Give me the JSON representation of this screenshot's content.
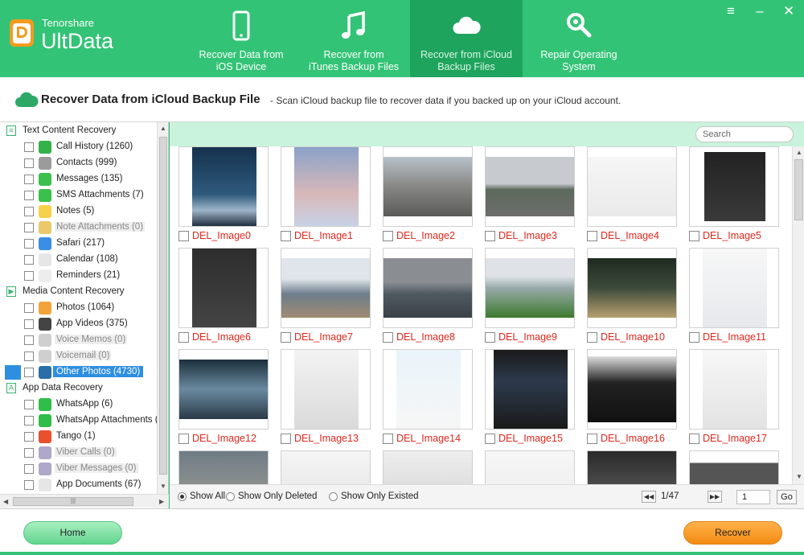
{
  "app": {
    "brand_sub": "Tenorshare",
    "brand_main": "UltData"
  },
  "window_buttons": {
    "menu": "≡",
    "minimize": "–",
    "close": "✕"
  },
  "tabs": [
    {
      "line1": "Recover Data from",
      "line2": "iOS Device",
      "icon": "phone-icon",
      "active": false
    },
    {
      "line1": "Recover from",
      "line2": "iTunes Backup Files",
      "icon": "music-note-icon",
      "active": false
    },
    {
      "line1": "Recover from iCloud",
      "line2": "Backup Files",
      "icon": "cloud-icon",
      "active": true
    },
    {
      "line1": "Repair Operating",
      "line2": "System",
      "icon": "wrench-icon",
      "active": false
    }
  ],
  "titleband": {
    "title": "Recover Data from iCloud Backup File",
    "subtitle": "- Scan iCloud backup file to recover data if you backed up on your iCloud account."
  },
  "tree": {
    "categories": [
      {
        "label": "Text Content Recovery",
        "icon": "≡"
      },
      {
        "label": "Media Content Recovery",
        "icon": "▶"
      },
      {
        "label": "App Data Recovery",
        "icon": "A"
      }
    ],
    "items": [
      {
        "label": "Call History (1260)",
        "icon": "phone-icon",
        "color": "#33b24a",
        "disabled": false
      },
      {
        "label": "Contacts (999)",
        "icon": "contacts-icon",
        "color": "#9b9b9b",
        "disabled": false
      },
      {
        "label": "Messages (135)",
        "icon": "message-icon",
        "color": "#3cc04c",
        "disabled": false
      },
      {
        "label": "SMS Attachments (7)",
        "icon": "paperclip-icon",
        "color": "#3cc04c",
        "disabled": false
      },
      {
        "label": "Notes (5)",
        "icon": "notes-icon",
        "color": "#f6d24a",
        "disabled": false
      },
      {
        "label": "Note Attachments (0)",
        "icon": "note-attachment-icon",
        "color": "#e9c96b",
        "disabled": true
      },
      {
        "label": "Safari (217)",
        "icon": "safari-icon",
        "color": "#3a8ee6",
        "disabled": false
      },
      {
        "label": "Calendar (108)",
        "icon": "calendar-icon",
        "color": "#e6e6e6",
        "disabled": false
      },
      {
        "label": "Reminders (21)",
        "icon": "reminders-icon",
        "color": "#ededed",
        "disabled": false
      },
      {
        "label": "Photos (1064)",
        "icon": "photos-icon",
        "color": "#f2a33a",
        "disabled": false
      },
      {
        "label": "App Videos (375)",
        "icon": "clapper-icon",
        "color": "#444444",
        "disabled": false
      },
      {
        "label": "Voice Memos (0)",
        "icon": "voice-memo-icon",
        "color": "#cfcfcf",
        "disabled": true
      },
      {
        "label": "Voicemail (0)",
        "icon": "voicemail-icon",
        "color": "#cfcfcf",
        "disabled": true
      },
      {
        "label": "Other Photos (4730)",
        "icon": "landscape-icon",
        "color": "#2a6ea8",
        "disabled": false,
        "selected": true
      },
      {
        "label": "WhatsApp (6)",
        "icon": "whatsapp-icon",
        "color": "#2fbe48",
        "disabled": false
      },
      {
        "label": "WhatsApp Attachments (",
        "icon": "whatsapp-attachment-icon",
        "color": "#2fbe48",
        "disabled": false
      },
      {
        "label": "Tango (1)",
        "icon": "tango-icon",
        "color": "#e8502e",
        "disabled": false
      },
      {
        "label": "Viber Calls (0)",
        "icon": "viber-calls-icon",
        "color": "#b0a8c8",
        "disabled": true
      },
      {
        "label": "Viber Messages (0)",
        "icon": "viber-messages-icon",
        "color": "#b0a8c8",
        "disabled": true
      },
      {
        "label": "App Documents (67)",
        "icon": "documents-icon",
        "color": "#e6e6e6",
        "disabled": false
      }
    ]
  },
  "search": {
    "placeholder": "Search"
  },
  "images": [
    "DEL_Image0",
    "DEL_Image1",
    "DEL_Image2",
    "DEL_Image3",
    "DEL_Image4",
    "DEL_Image5",
    "DEL_Image6",
    "DEL_Image7",
    "DEL_Image8",
    "DEL_Image9",
    "DEL_Image10",
    "DEL_Image11",
    "DEL_Image12",
    "DEL_Image13",
    "DEL_Image14",
    "DEL_Image15",
    "DEL_Image16",
    "DEL_Image17"
  ],
  "filters": {
    "show_all": "Show All",
    "show_deleted": "Show Only Deleted",
    "show_existed": "Show Only Existed",
    "selected": "show_all"
  },
  "pagination": {
    "prev": "◀◀",
    "current": "1/47",
    "next": "▶▶",
    "page_input": "1",
    "go": "Go"
  },
  "footer": {
    "home": "Home",
    "recover": "Recover"
  },
  "colors": {
    "brand_green": "#33c376",
    "tab_active": "#1fa45d",
    "deleted_red": "#e0281d",
    "recover_orange": "#f38b13",
    "selection_blue": "#2e8fe0"
  }
}
